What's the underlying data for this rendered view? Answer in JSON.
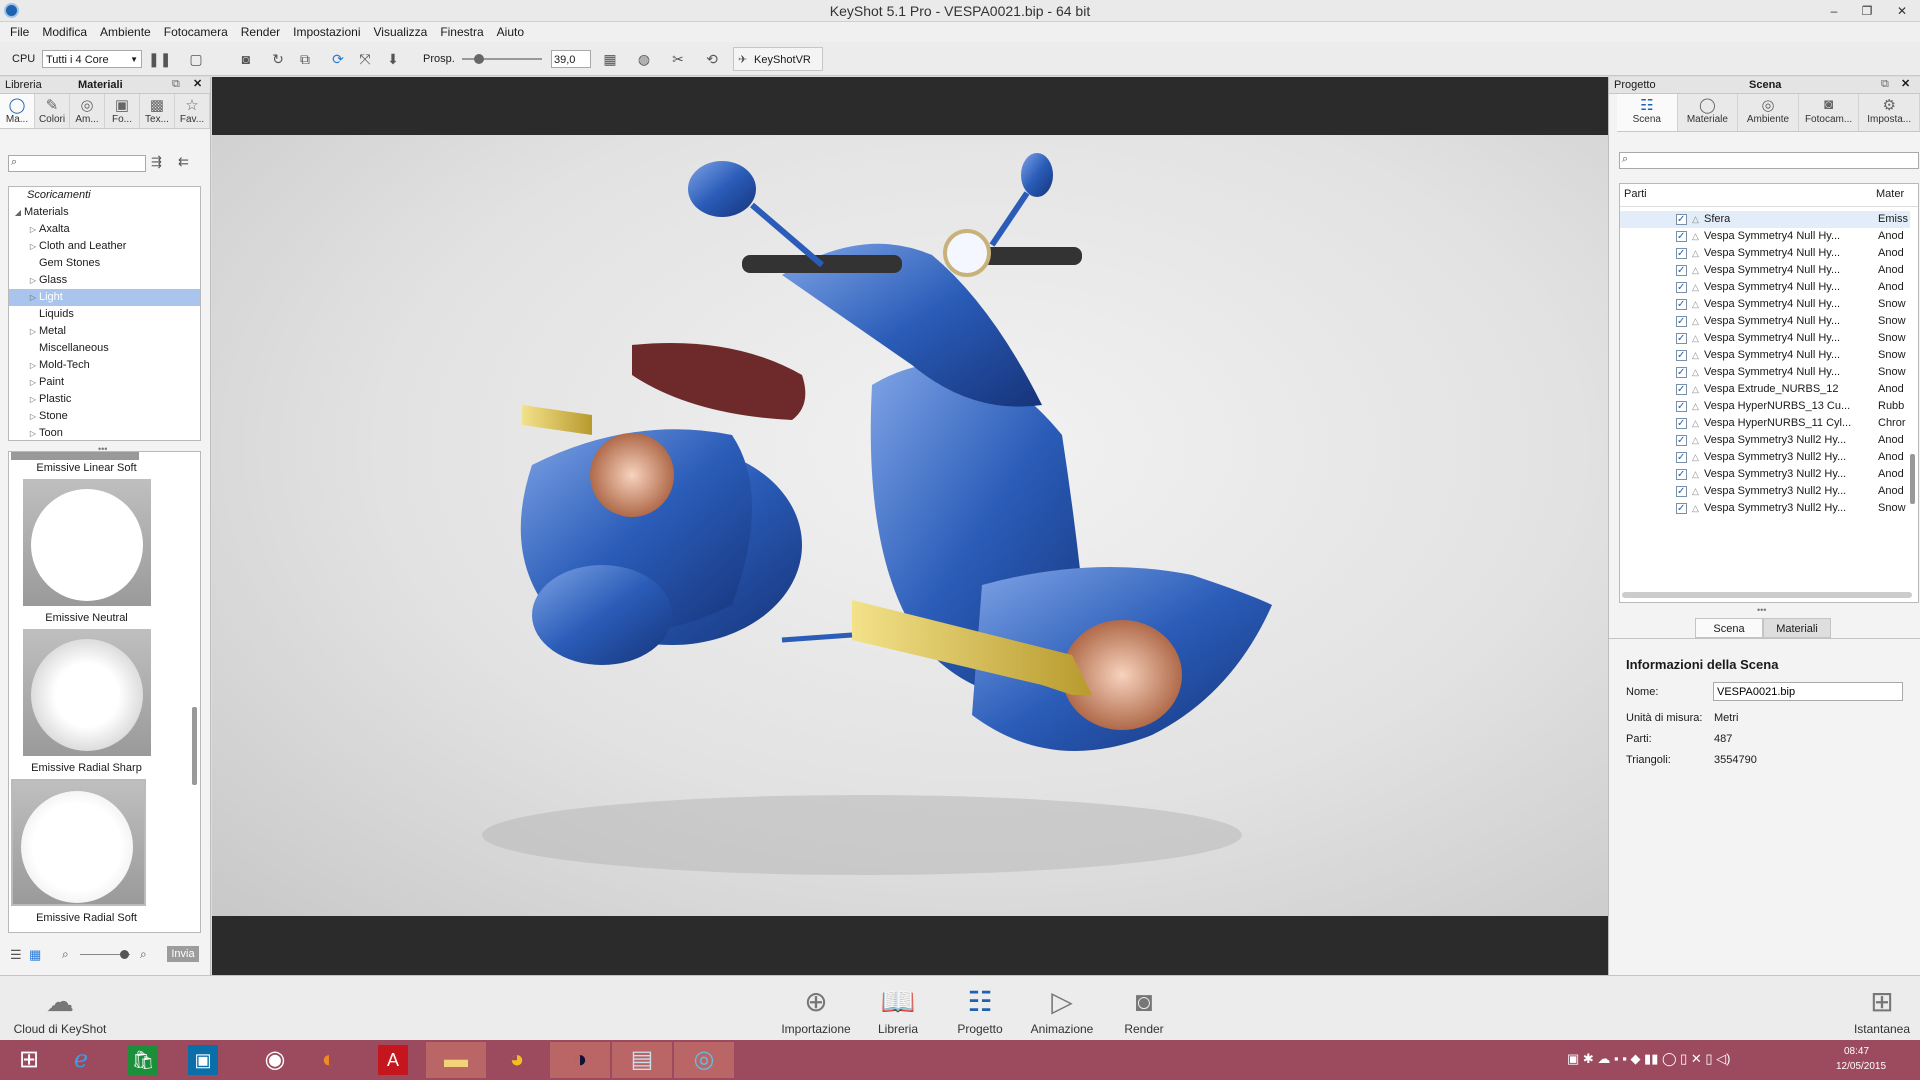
{
  "window": {
    "title": "KeyShot 5.1 Pro  - VESPA0021.bip  - 64 bit",
    "min": "–",
    "max": "❐",
    "close": "✕"
  },
  "menu": [
    "File",
    "Modifica",
    "Ambiente",
    "Fotocamera",
    "Render",
    "Impostazioni",
    "Visualizza",
    "Finestra",
    "Aiuto"
  ],
  "toolbar": {
    "cpu_label": "CPU",
    "cpu_value": "Tutti i 4 Core",
    "persp_label": "Prosp.",
    "persp_value": "39,0",
    "keyshotvr": "KeyShotVR"
  },
  "left": {
    "header_left": "Libreria",
    "header_title": "Materiali",
    "tabs": [
      "Ma...",
      "Colori",
      "Am...",
      "Fo...",
      "Tex...",
      "Fav..."
    ],
    "search_placeholder": "",
    "tree": [
      {
        "label": "Scoricamenti",
        "italic": true
      },
      {
        "label": "Materials",
        "expanded": true
      },
      {
        "label": "Axalta",
        "child": true
      },
      {
        "label": "Cloth and Leather",
        "child": true
      },
      {
        "label": "Gem Stones",
        "child": true,
        "leaf": true
      },
      {
        "label": "Glass",
        "child": true
      },
      {
        "label": "Light",
        "child": true,
        "selected": true
      },
      {
        "label": "Liquids",
        "child": true,
        "leaf": true
      },
      {
        "label": "Metal",
        "child": true
      },
      {
        "label": "Miscellaneous",
        "child": true,
        "leaf": true
      },
      {
        "label": "Mold-Tech",
        "child": true
      },
      {
        "label": "Paint",
        "child": true
      },
      {
        "label": "Plastic",
        "child": true
      },
      {
        "label": "Stone",
        "child": true
      },
      {
        "label": "Toon",
        "child": true
      }
    ],
    "thumbs": [
      "Emissive Linear Soft",
      "Emissive Neutral",
      "Emissive Radial Sharp",
      "Emissive Radial Soft"
    ],
    "send_button": "Invia"
  },
  "right": {
    "header_left": "Progetto",
    "header_title": "Scena",
    "tabs": [
      "Scena",
      "Materiale",
      "Ambiente",
      "Fotocam...",
      "Imposta..."
    ],
    "col_parts": "Parti",
    "col_mat": "Mater",
    "parts": [
      {
        "name": "Sfera",
        "mat": "Emiss"
      },
      {
        "name": "Vespa Symmetry4 Null Hy...",
        "mat": "Anod"
      },
      {
        "name": "Vespa Symmetry4 Null Hy...",
        "mat": "Anod"
      },
      {
        "name": "Vespa Symmetry4 Null Hy...",
        "mat": "Anod"
      },
      {
        "name": "Vespa Symmetry4 Null Hy...",
        "mat": "Anod"
      },
      {
        "name": "Vespa Symmetry4 Null Hy...",
        "mat": "Snow"
      },
      {
        "name": "Vespa Symmetry4 Null Hy...",
        "mat": "Snow"
      },
      {
        "name": "Vespa Symmetry4 Null Hy...",
        "mat": "Snow"
      },
      {
        "name": "Vespa Symmetry4 Null Hy...",
        "mat": "Snow"
      },
      {
        "name": "Vespa Symmetry4 Null Hy...",
        "mat": "Snow"
      },
      {
        "name": "Vespa Extrude_NURBS_12",
        "mat": "Anod"
      },
      {
        "name": "Vespa HyperNURBS_13 Cu...",
        "mat": "Rubb"
      },
      {
        "name": "Vespa HyperNURBS_11 Cyl...",
        "mat": "Chror"
      },
      {
        "name": "Vespa Symmetry3 Null2 Hy...",
        "mat": "Anod"
      },
      {
        "name": "Vespa Symmetry3 Null2 Hy...",
        "mat": "Anod"
      },
      {
        "name": "Vespa Symmetry3 Null2 Hy...",
        "mat": "Anod"
      },
      {
        "name": "Vespa Symmetry3 Null2 Hy...",
        "mat": "Anod"
      },
      {
        "name": "Vespa Symmetry3 Null2 Hy...",
        "mat": "Snow"
      }
    ],
    "subtabs": [
      "Scena",
      "Materiali"
    ],
    "info_title": "Informazioni della Scena",
    "info": {
      "name_label": "Nome:",
      "name_value": "VESPA0021.bip",
      "units_label": "Unità di misura:",
      "units_value": "Metri",
      "parts_label": "Parti:",
      "parts_value": "487",
      "tri_label": "Triangoli:",
      "tri_value": "3554790"
    }
  },
  "bottom": {
    "cloud": "Cloud di KeyShot",
    "buttons": [
      "Importazione",
      "Libreria",
      "Progetto",
      "Animazione",
      "Render"
    ],
    "snapshot": "Istantanea"
  },
  "taskbar": {
    "time": "08:47",
    "date": "12/05/2015"
  },
  "colors": {
    "accent": "#1e62b0",
    "selection": "#a9c5ee",
    "taskbar": "#9c4a5d",
    "vespa": "#2a5cb8"
  }
}
